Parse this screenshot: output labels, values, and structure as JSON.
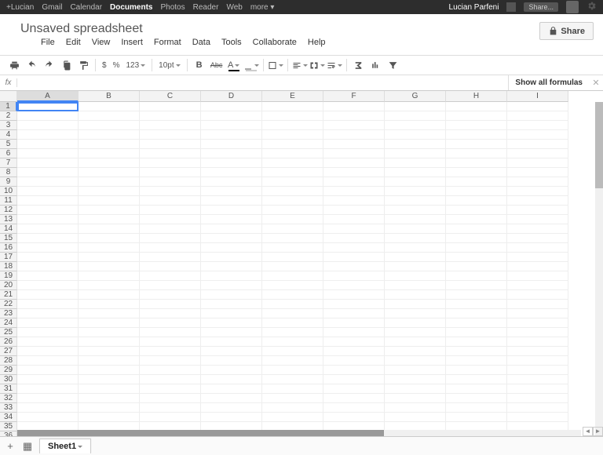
{
  "gbar": {
    "left": [
      "+Lucian",
      "Gmail",
      "Calendar",
      "Documents",
      "Photos",
      "Reader",
      "Web",
      "more ▾"
    ],
    "active_index": 3,
    "user": "Lucian Parfeni",
    "share": "Share..."
  },
  "doc": {
    "title": "Unsaved spreadsheet"
  },
  "share_button": "Share",
  "menus": [
    "File",
    "Edit",
    "View",
    "Insert",
    "Format",
    "Data",
    "Tools",
    "Collaborate",
    "Help"
  ],
  "toolbar": {
    "currency": "$",
    "percent": "%",
    "numfmt": "123",
    "font_size": "10pt",
    "bold": "B",
    "strike": "Abc"
  },
  "fx": {
    "label": "fx",
    "show_all": "Show all formulas",
    "close": "✕"
  },
  "columns": [
    "A",
    "B",
    "C",
    "D",
    "E",
    "F",
    "G",
    "H",
    "I"
  ],
  "row_count": 36,
  "selected": {
    "col": 0,
    "row": 1
  },
  "tabs": {
    "sheet": "Sheet1"
  }
}
